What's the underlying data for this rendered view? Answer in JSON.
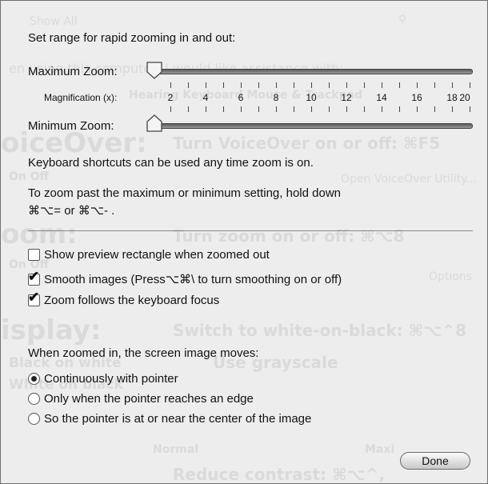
{
  "ghosts": {
    "show_all": "Show All",
    "assistance": "en using this computer, I would like assistance with:",
    "tabs": "Hearing   Keyboard   Mouse & Trackpad",
    "voiceover": "oiceOver:",
    "voiceover_shortcut": "Turn VoiceOver on or off: ⌘F5",
    "on_off": "On   Off",
    "open_vo_utility": "Open VoiceOver Utility...",
    "zoom": "oom:",
    "zoom_shortcut": "Turn zoom on or off: ⌘⌥8",
    "options": "Options",
    "display": "isplay:",
    "display_shortcut": "Switch to white-on-black: ⌘⌥⌃8",
    "black_on_white": "Black on white",
    "use_grayscale": "Use grayscale",
    "white_on_black": "White on black",
    "normal": "Normal",
    "maximum": "Maxi",
    "reduce_contrast": "Reduce contrast: ⌘⌥^,"
  },
  "header": "Set range for rapid zooming in and out:",
  "max_zoom": {
    "label": "Maximum Zoom:",
    "value": 1
  },
  "magnification_label": "Magnification (x):",
  "scale_labels": [
    "2",
    "4",
    "6",
    "8",
    "10",
    "12",
    "14",
    "16",
    "18",
    "20"
  ],
  "min_zoom": {
    "label": "Minimum Zoom:",
    "value": 1
  },
  "shortcuts_line": "Keyboard shortcuts can be used any time zoom is on.",
  "past_max_line1": "To zoom past the maximum or minimum setting, hold down",
  "past_max_line2": "⌘⌥= or ⌘⌥- .",
  "checkboxes": [
    {
      "label": "Show preview rectangle when zoomed out",
      "checked": false
    },
    {
      "label": "Smooth images (Press⌥⌘\\ to turn smoothing on or off)",
      "checked": true
    },
    {
      "label": "Zoom follows the keyboard focus",
      "checked": true
    }
  ],
  "moves_label": "When zoomed in, the screen image moves:",
  "radios": [
    {
      "label": "Continuously with pointer",
      "selected": true
    },
    {
      "label": "Only when the pointer reaches an edge",
      "selected": false
    },
    {
      "label": "So the pointer is at or near the center of the image",
      "selected": false
    }
  ],
  "done_label": "Done",
  "check_mark": "✔"
}
